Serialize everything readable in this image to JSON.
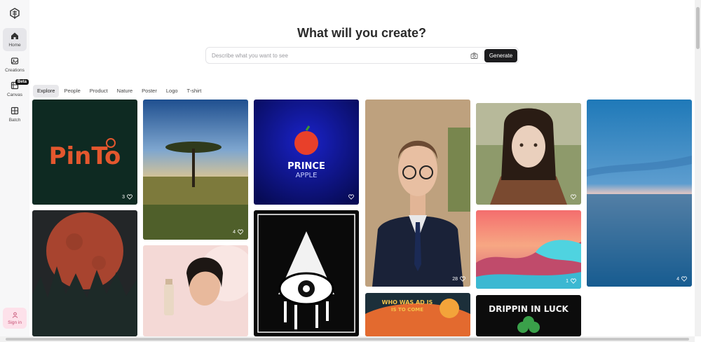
{
  "sidebar": {
    "items": [
      {
        "label": "Home"
      },
      {
        "label": "Creations"
      },
      {
        "label": "Canvas"
      },
      {
        "label": "Batch"
      }
    ],
    "beta_badge": "Beta",
    "signin_label": "Sign in"
  },
  "header": {
    "headline": "What will you create?"
  },
  "search": {
    "placeholder": "Describe what you want to see",
    "value": "",
    "generate_label": "Generate"
  },
  "tabs": [
    {
      "label": "Explore",
      "active": true
    },
    {
      "label": "People"
    },
    {
      "label": "Product"
    },
    {
      "label": "Nature"
    },
    {
      "label": "Poster"
    },
    {
      "label": "Logo"
    },
    {
      "label": "T-shirt"
    }
  ],
  "gallery": [
    {
      "subject": "Pinto logo",
      "logo_text": "PinTo",
      "likes": "3"
    },
    {
      "subject": "Moon over forest",
      "likes": ""
    },
    {
      "subject": "Acacia tree savanna",
      "likes": "4"
    },
    {
      "subject": "Woman with skincare bottle",
      "likes": ""
    },
    {
      "subject": "Prince Apple logo",
      "logo_line1": "PRINCE",
      "logo_line2": "APPLE",
      "likes": ""
    },
    {
      "subject": "Eye pyramid poster",
      "likes": ""
    },
    {
      "subject": "Man in suit with glasses",
      "likes": "28"
    },
    {
      "subject": "Poster",
      "poster_line1": "WHO WAS AD IS",
      "poster_line2": "IS TO COME",
      "likes": ""
    },
    {
      "subject": "Girl in brown coat",
      "likes": ""
    },
    {
      "subject": "Pink ocean waves",
      "likes": "1"
    },
    {
      "subject": "Drippin in luck shirt",
      "shirt_text": "DRIPPIN IN LUCK",
      "likes": ""
    },
    {
      "subject": "Calm ocean sky",
      "likes": "4"
    }
  ],
  "colors": {
    "accent_dark": "#1c1c1e",
    "signin_bg": "#fde1ea",
    "pinto_orange": "#e4572e"
  }
}
